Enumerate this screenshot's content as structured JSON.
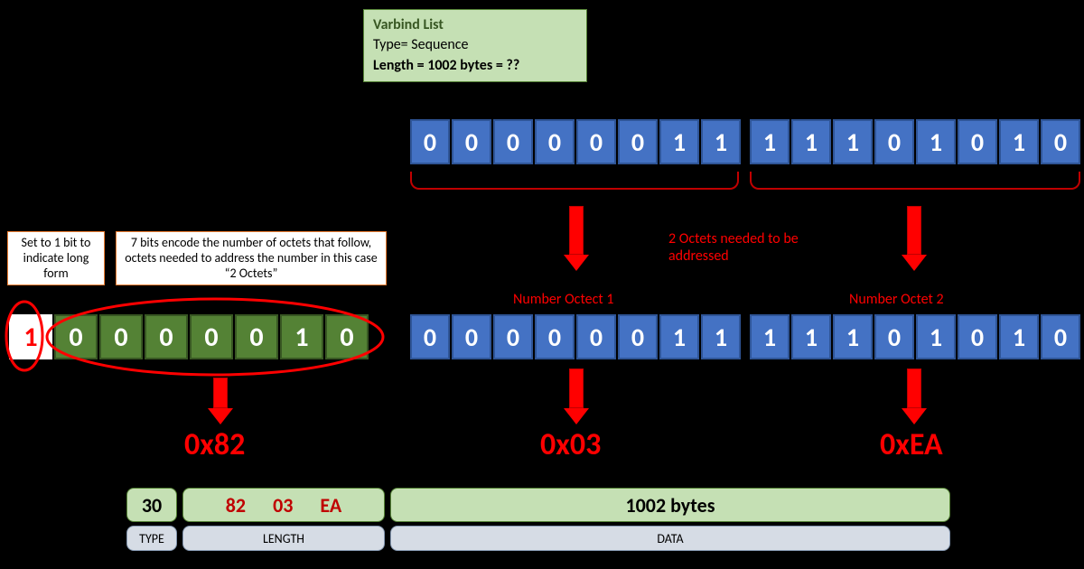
{
  "varbind": {
    "title": "Varbind List",
    "type_line": "Type= Sequence",
    "length_line": "Length = 1002 bytes = ??"
  },
  "notes": {
    "long_form": "Set to 1 bit to indicate long form",
    "seven_bits": "7 bits encode the number of octets that follow,  octets needed to address the number in this case “2 Octets”",
    "two_octets_needed": "2 Octets needed to be addressed",
    "num_octet_1": "Number Octect 1",
    "num_octet_2": "Number Octet 2"
  },
  "bits": {
    "green": [
      "1",
      "0",
      "0",
      "0",
      "0",
      "0",
      "1",
      "0"
    ],
    "blue_top_1": [
      "0",
      "0",
      "0",
      "0",
      "0",
      "0",
      "1",
      "1"
    ],
    "blue_top_2": [
      "1",
      "1",
      "1",
      "0",
      "1",
      "0",
      "1",
      "0"
    ],
    "blue_bot_1": [
      "0",
      "0",
      "0",
      "0",
      "0",
      "0",
      "1",
      "1"
    ],
    "blue_bot_2": [
      "1",
      "1",
      "1",
      "0",
      "1",
      "0",
      "1",
      "0"
    ]
  },
  "hex": {
    "h82": "0x82",
    "h03": "0x03",
    "hEA": "0xEA"
  },
  "tlv": {
    "type_val": "30",
    "len_b1": "82",
    "len_b2": "03",
    "len_b3": "EA",
    "data_val": "1002 bytes",
    "type_lbl": "TYPE",
    "length_lbl": "LENGTH",
    "data_lbl": "DATA"
  }
}
